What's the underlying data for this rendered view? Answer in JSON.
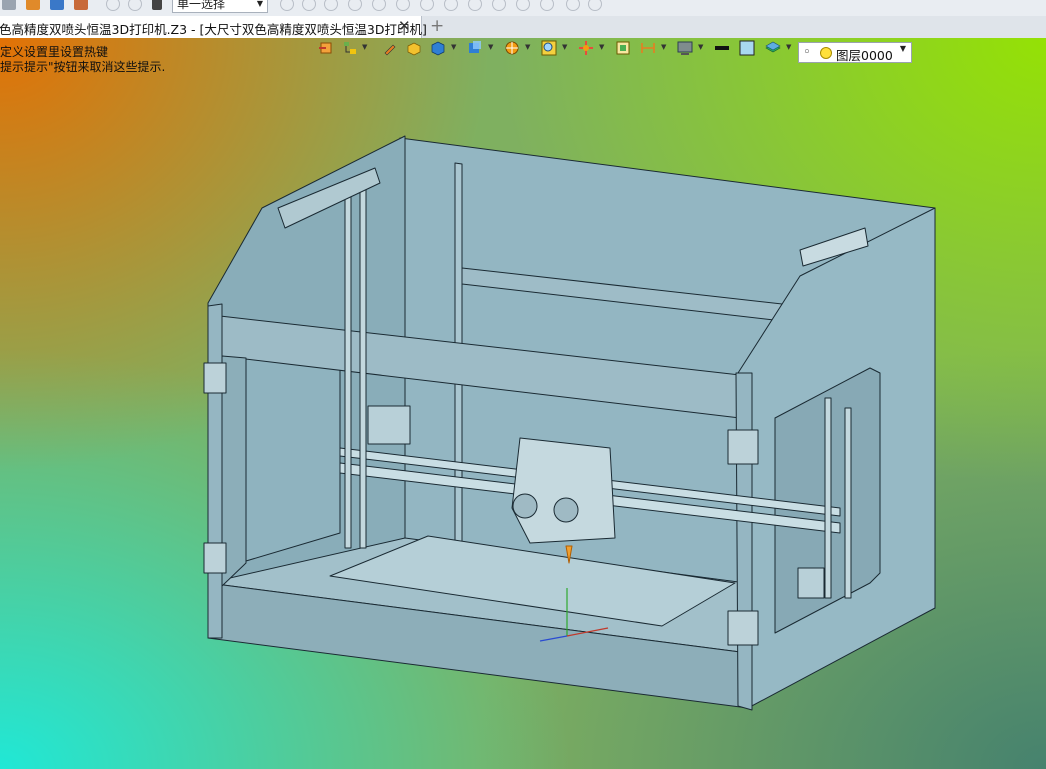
{
  "toolbar_top": {
    "select_mode": "单一选择"
  },
  "tabs": [
    {
      "title": "色高精度双喷头恒温3D打印机.Z3 - [大尺寸双色高精度双喷头恒温3D打印机]",
      "active": true
    }
  ],
  "hints": [
    "定义设置里设置热键",
    "提示提示\"按钮来取消这些提示."
  ],
  "layer": {
    "name": "图层0000"
  },
  "icons": {
    "tab_close": "✕",
    "tab_add": "+",
    "bulb": "💡"
  },
  "colors": {
    "bg_top_left": "#e86e00",
    "bg_top_right": "#96e400",
    "bg_bottom_left": "#20e8d6",
    "bg_bottom_right": "#46826e",
    "model_body": "#8fb2bf",
    "model_edge": "#1a2a33"
  }
}
